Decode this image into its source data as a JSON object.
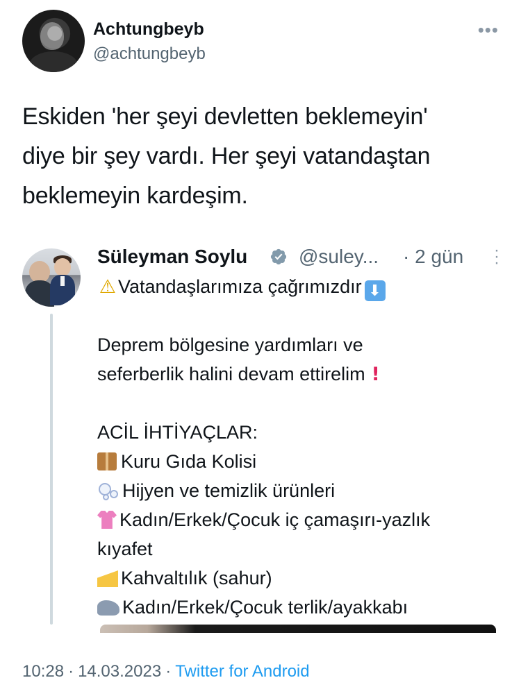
{
  "author": {
    "name": "Achtungbeyb",
    "handle": "@achtungbeyb",
    "more_icon": "more-horizontal-icon"
  },
  "tweet": {
    "text": "Eskiden 'her şeyi devletten beklemeyin'\ndiye bir şey vardı. Her şeyi vatandaştan\nbeklemeyin kardeşim."
  },
  "quoted": {
    "name": "Süleyman Soylu",
    "verified_icon": "verified-badge-icon",
    "handle": "@suley...",
    "time": "· 2 gün",
    "menu_icon": "vertical-more-icon",
    "lines": {
      "l1": "Vatandaşlarımıza çağrımızdır",
      "l2": "Deprem bölgesine yardımları ve",
      "l3": "seferberlik halini devam ettirelim",
      "l4": "ACİL İHTİYAÇLAR:",
      "l5": "Kuru Gıda Kolisi",
      "l6": "Hijyen ve temizlik ürünleri",
      "l7": "Kadın/Erkek/Çocuk iç çamaşırı-yazlık",
      "l8": "kıyafet",
      "l9": "Kahvaltılık (sahur)",
      "l10": "Kadın/Erkek/Çocuk terlik/ayakkabı"
    }
  },
  "meta": {
    "time": "10:28",
    "date": "14.03.2023",
    "source": "Twitter for Android",
    "separator": "·"
  },
  "colors": {
    "text": "#0f1419",
    "secondary": "#536471",
    "link": "#1d9bf0",
    "verified": "#829aab",
    "thread_line": "#cfd9de"
  }
}
